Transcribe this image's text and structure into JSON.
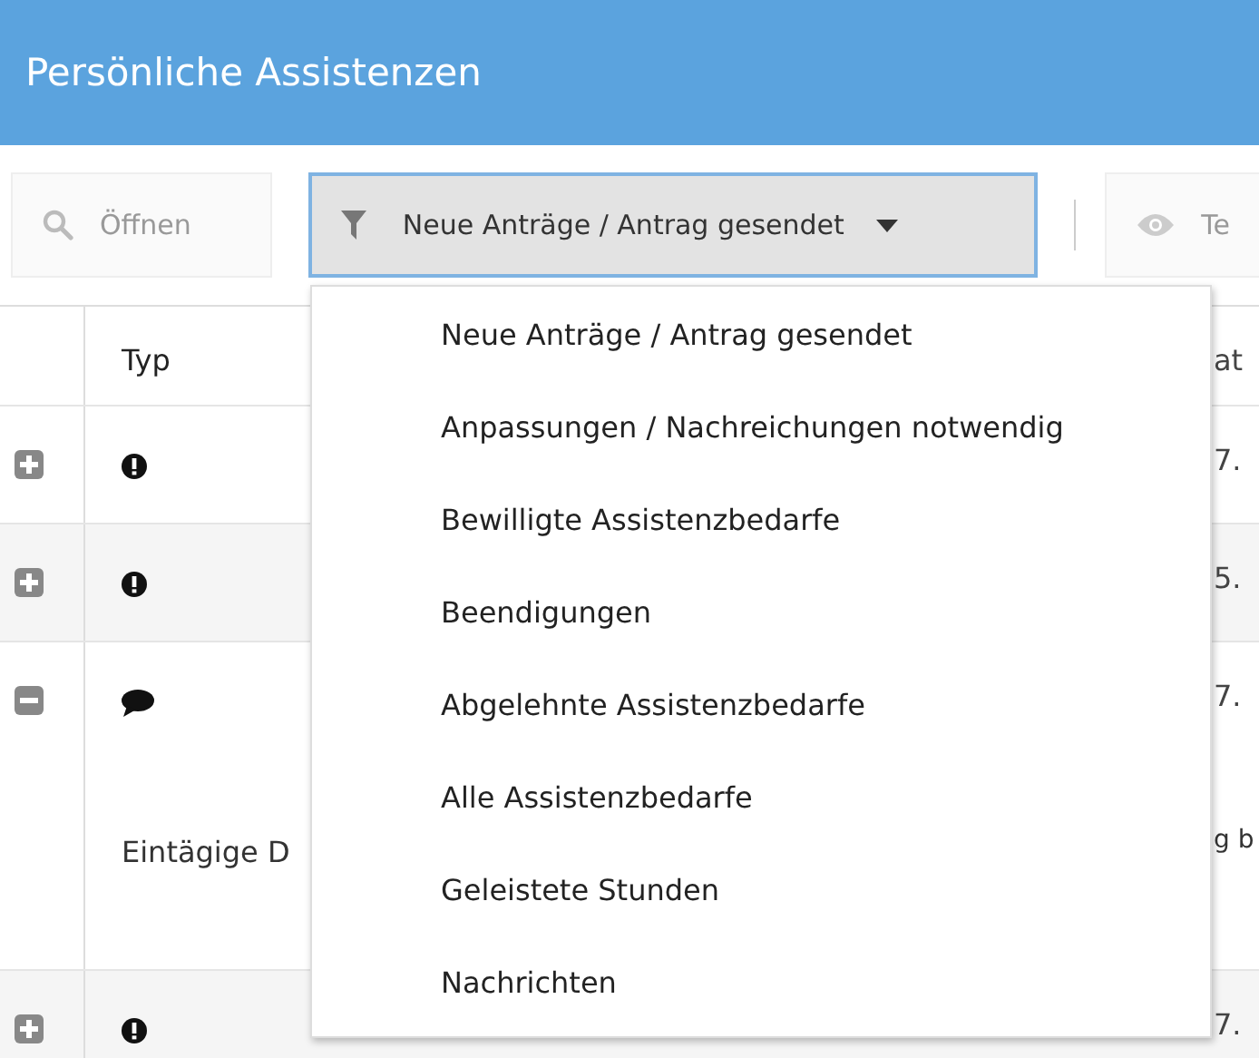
{
  "header": {
    "title": "Persönliche Assistenzen"
  },
  "toolbar": {
    "open_button": "Öffnen",
    "filter": {
      "label": "Neue Anträge / Antrag gesendet",
      "open": true
    },
    "view_button": "Te"
  },
  "table": {
    "columns": [
      "Typ",
      "at"
    ],
    "rows": [
      {
        "expanded": false,
        "kind": "alert",
        "column_3": "7."
      },
      {
        "expanded": false,
        "kind": "alert",
        "column_3": "5."
      },
      {
        "expanded": true,
        "kind": "message",
        "column_3": "7.",
        "detail": "Eintägige D",
        "detail_end": "g b"
      },
      {
        "expanded": false,
        "kind": "alert",
        "column_3": "7."
      }
    ]
  },
  "dropdown": {
    "items": [
      {
        "label": "Neue Anträge / Antrag gesendet"
      },
      {
        "label": "Anpassungen / Nachreichungen notwendig"
      },
      {
        "label": "Bewilligte Assistenzbedarfe"
      },
      {
        "label": "Beendigungen"
      },
      {
        "label": "Abgelehnte Assistenzbedarfe"
      },
      {
        "label": "Alle Assistenzbedarfe"
      },
      {
        "label": "Geleistete Stunden"
      },
      {
        "label": "Nachrichten"
      }
    ]
  }
}
